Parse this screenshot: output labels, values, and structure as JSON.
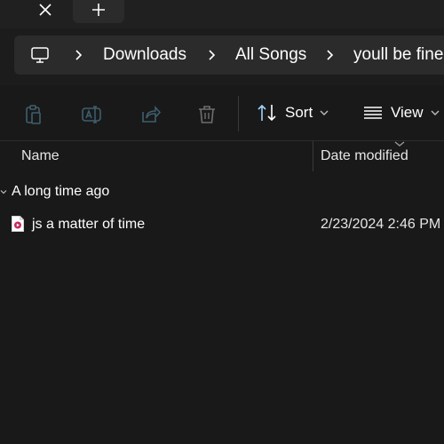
{
  "tabstrip": {
    "close_icon": "close-icon",
    "new_tab_icon": "plus-icon"
  },
  "address": {
    "root_icon": "computer-icon",
    "breadcrumbs": [
      "Downloads",
      "All Songs",
      "youll be fine"
    ]
  },
  "toolbar": {
    "icons": [
      "paste-icon",
      "rename-icon",
      "share-icon",
      "delete-icon"
    ],
    "sort_label": "Sort",
    "view_label": "View"
  },
  "columns": {
    "name": "Name",
    "date_modified": "Date modified"
  },
  "group": {
    "label": "A long time ago"
  },
  "files": [
    {
      "name": "js a matter of time",
      "date_modified": "2/23/2024 2:46 PM",
      "icon": "audio-file-icon"
    }
  ],
  "colors": {
    "background": "#191919",
    "address_bar": "#2b2b2b",
    "accent_file_icon": "#c42b5c"
  }
}
